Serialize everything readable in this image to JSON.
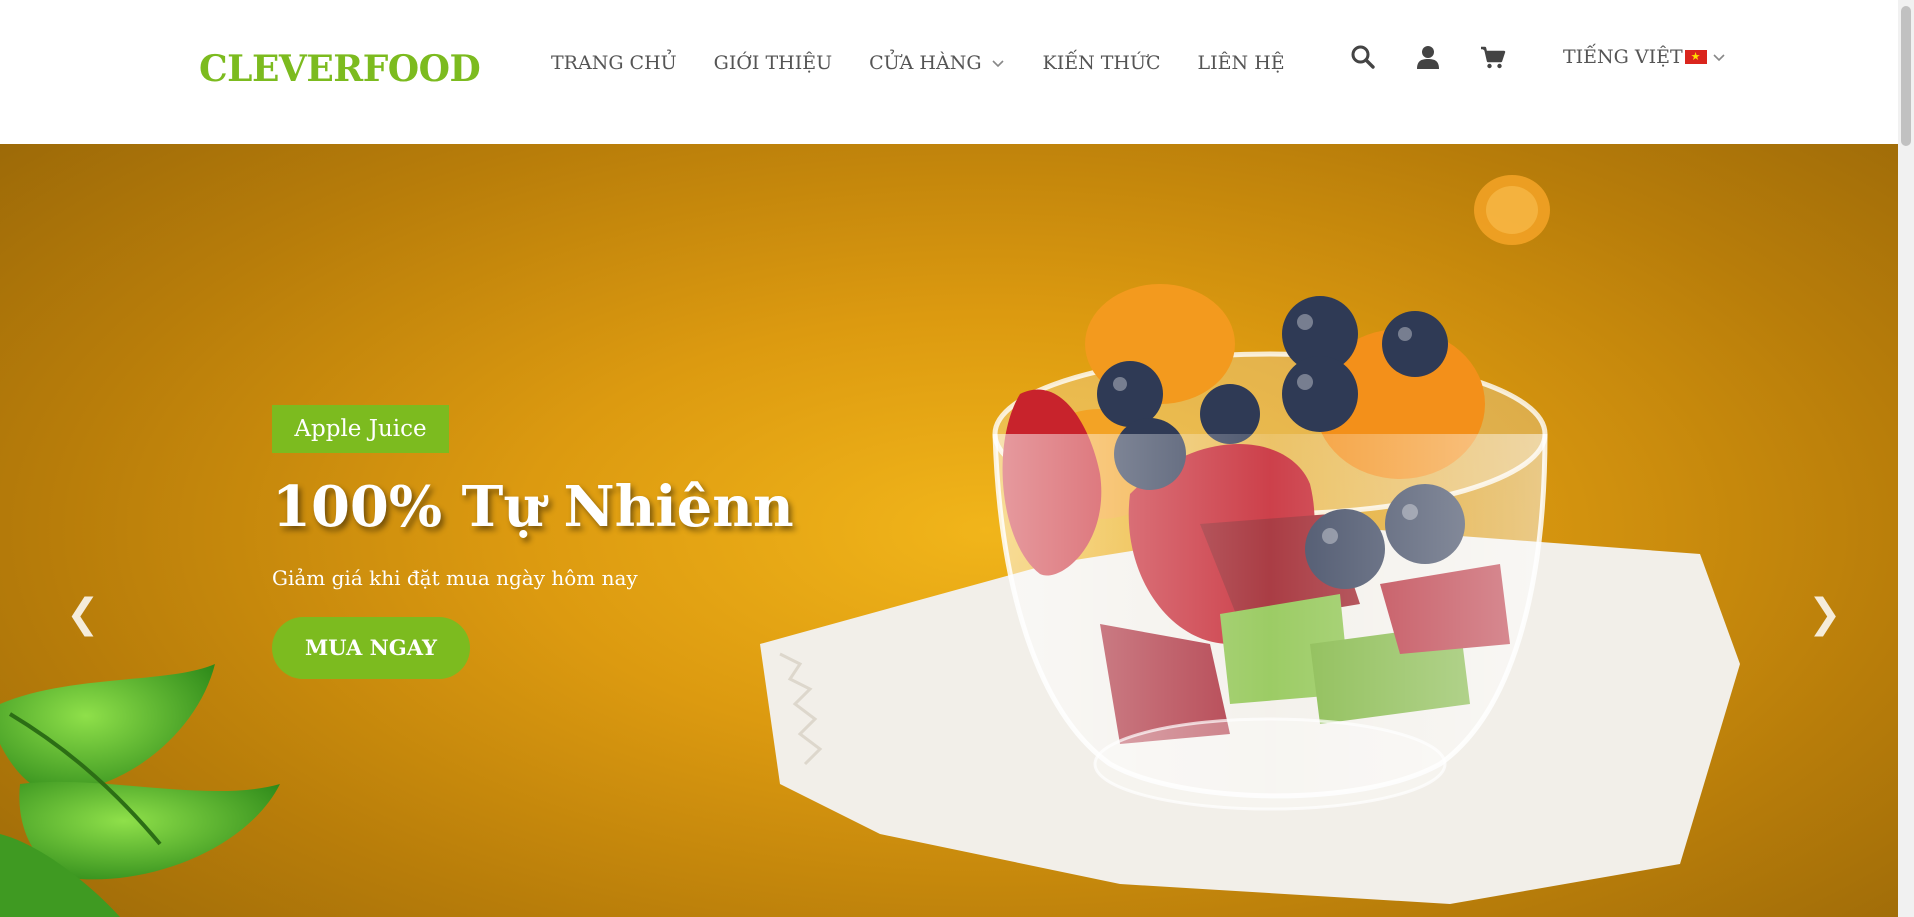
{
  "header": {
    "logo": "CLEVERFOOD",
    "nav": [
      {
        "label": "TRANG CHỦ"
      },
      {
        "label": "GIỚI THIỆU"
      },
      {
        "label": "CỬA HÀNG",
        "has_dropdown": true
      },
      {
        "label": "KIẾN THỨC"
      },
      {
        "label": "LIÊN HỆ"
      }
    ],
    "icons": [
      "search-icon",
      "user-icon",
      "cart-icon"
    ],
    "language": "TIẾNG VIỆT",
    "flag_icon": "vietnam-flag-icon"
  },
  "hero": {
    "badge": "Apple Juice",
    "headline": "100% Tự Nhiênn",
    "subtitle": "Giảm giá khi đặt mua ngày hôm nay",
    "cta": "MUA NGAY",
    "prev_arrow": "❮",
    "next_arrow": "❯"
  },
  "colors": {
    "brand_green": "#7cbb1f",
    "hero_orange": "#dc9a10",
    "nav_text": "#555555"
  }
}
